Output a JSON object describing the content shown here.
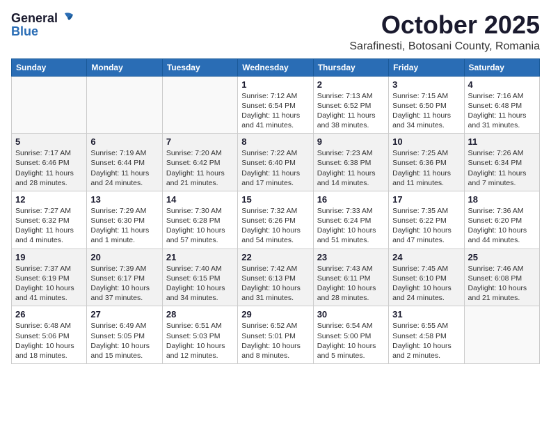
{
  "header": {
    "logo_general": "General",
    "logo_blue": "Blue",
    "month": "October 2025",
    "location": "Sarafinesti, Botosani County, Romania"
  },
  "days_of_week": [
    "Sunday",
    "Monday",
    "Tuesday",
    "Wednesday",
    "Thursday",
    "Friday",
    "Saturday"
  ],
  "weeks": [
    [
      {
        "day": "",
        "info": ""
      },
      {
        "day": "",
        "info": ""
      },
      {
        "day": "",
        "info": ""
      },
      {
        "day": "1",
        "info": "Sunrise: 7:12 AM\nSunset: 6:54 PM\nDaylight: 11 hours and 41 minutes."
      },
      {
        "day": "2",
        "info": "Sunrise: 7:13 AM\nSunset: 6:52 PM\nDaylight: 11 hours and 38 minutes."
      },
      {
        "day": "3",
        "info": "Sunrise: 7:15 AM\nSunset: 6:50 PM\nDaylight: 11 hours and 34 minutes."
      },
      {
        "day": "4",
        "info": "Sunrise: 7:16 AM\nSunset: 6:48 PM\nDaylight: 11 hours and 31 minutes."
      }
    ],
    [
      {
        "day": "5",
        "info": "Sunrise: 7:17 AM\nSunset: 6:46 PM\nDaylight: 11 hours and 28 minutes."
      },
      {
        "day": "6",
        "info": "Sunrise: 7:19 AM\nSunset: 6:44 PM\nDaylight: 11 hours and 24 minutes."
      },
      {
        "day": "7",
        "info": "Sunrise: 7:20 AM\nSunset: 6:42 PM\nDaylight: 11 hours and 21 minutes."
      },
      {
        "day": "8",
        "info": "Sunrise: 7:22 AM\nSunset: 6:40 PM\nDaylight: 11 hours and 17 minutes."
      },
      {
        "day": "9",
        "info": "Sunrise: 7:23 AM\nSunset: 6:38 PM\nDaylight: 11 hours and 14 minutes."
      },
      {
        "day": "10",
        "info": "Sunrise: 7:25 AM\nSunset: 6:36 PM\nDaylight: 11 hours and 11 minutes."
      },
      {
        "day": "11",
        "info": "Sunrise: 7:26 AM\nSunset: 6:34 PM\nDaylight: 11 hours and 7 minutes."
      }
    ],
    [
      {
        "day": "12",
        "info": "Sunrise: 7:27 AM\nSunset: 6:32 PM\nDaylight: 11 hours and 4 minutes."
      },
      {
        "day": "13",
        "info": "Sunrise: 7:29 AM\nSunset: 6:30 PM\nDaylight: 11 hours and 1 minute."
      },
      {
        "day": "14",
        "info": "Sunrise: 7:30 AM\nSunset: 6:28 PM\nDaylight: 10 hours and 57 minutes."
      },
      {
        "day": "15",
        "info": "Sunrise: 7:32 AM\nSunset: 6:26 PM\nDaylight: 10 hours and 54 minutes."
      },
      {
        "day": "16",
        "info": "Sunrise: 7:33 AM\nSunset: 6:24 PM\nDaylight: 10 hours and 51 minutes."
      },
      {
        "day": "17",
        "info": "Sunrise: 7:35 AM\nSunset: 6:22 PM\nDaylight: 10 hours and 47 minutes."
      },
      {
        "day": "18",
        "info": "Sunrise: 7:36 AM\nSunset: 6:20 PM\nDaylight: 10 hours and 44 minutes."
      }
    ],
    [
      {
        "day": "19",
        "info": "Sunrise: 7:37 AM\nSunset: 6:19 PM\nDaylight: 10 hours and 41 minutes."
      },
      {
        "day": "20",
        "info": "Sunrise: 7:39 AM\nSunset: 6:17 PM\nDaylight: 10 hours and 37 minutes."
      },
      {
        "day": "21",
        "info": "Sunrise: 7:40 AM\nSunset: 6:15 PM\nDaylight: 10 hours and 34 minutes."
      },
      {
        "day": "22",
        "info": "Sunrise: 7:42 AM\nSunset: 6:13 PM\nDaylight: 10 hours and 31 minutes."
      },
      {
        "day": "23",
        "info": "Sunrise: 7:43 AM\nSunset: 6:11 PM\nDaylight: 10 hours and 28 minutes."
      },
      {
        "day": "24",
        "info": "Sunrise: 7:45 AM\nSunset: 6:10 PM\nDaylight: 10 hours and 24 minutes."
      },
      {
        "day": "25",
        "info": "Sunrise: 7:46 AM\nSunset: 6:08 PM\nDaylight: 10 hours and 21 minutes."
      }
    ],
    [
      {
        "day": "26",
        "info": "Sunrise: 6:48 AM\nSunset: 5:06 PM\nDaylight: 10 hours and 18 minutes."
      },
      {
        "day": "27",
        "info": "Sunrise: 6:49 AM\nSunset: 5:05 PM\nDaylight: 10 hours and 15 minutes."
      },
      {
        "day": "28",
        "info": "Sunrise: 6:51 AM\nSunset: 5:03 PM\nDaylight: 10 hours and 12 minutes."
      },
      {
        "day": "29",
        "info": "Sunrise: 6:52 AM\nSunset: 5:01 PM\nDaylight: 10 hours and 8 minutes."
      },
      {
        "day": "30",
        "info": "Sunrise: 6:54 AM\nSunset: 5:00 PM\nDaylight: 10 hours and 5 minutes."
      },
      {
        "day": "31",
        "info": "Sunrise: 6:55 AM\nSunset: 4:58 PM\nDaylight: 10 hours and 2 minutes."
      },
      {
        "day": "",
        "info": ""
      }
    ]
  ]
}
